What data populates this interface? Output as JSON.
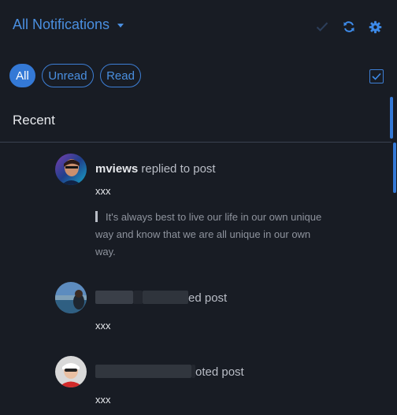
{
  "header": {
    "title": "All Notifications",
    "icons": [
      "check-icon",
      "refresh-icon",
      "gear-icon"
    ]
  },
  "filters": {
    "all": "All",
    "unread": "Unread",
    "read": "Read"
  },
  "section": {
    "title": "Recent"
  },
  "notifications": [
    {
      "user": "mviews",
      "action": " replied to post",
      "body": "xxx",
      "quote": "It's always best to live our life in our own unique way and know that we are all unique in our own way."
    },
    {
      "user": "",
      "action": "ed post",
      "body": "xxx"
    },
    {
      "user": "",
      "action": "oted post",
      "body": "xxx"
    }
  ],
  "colors": {
    "background": "#181c24",
    "accent": "#3479d6",
    "text": "#e6e8ec",
    "muted": "#8e939d"
  }
}
